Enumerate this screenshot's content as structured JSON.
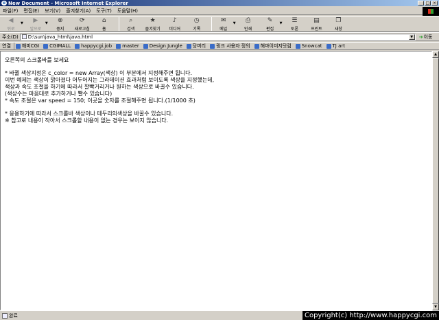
{
  "window": {
    "title": "New Document - Microsoft Internet Explorer",
    "buttons": {
      "minimize": "_",
      "maximize": "□",
      "close": "×"
    }
  },
  "menu": [
    "파일(F)",
    "편집(E)",
    "보기(V)",
    "즐겨찾기(A)",
    "도구(T)",
    "도움말(H)"
  ],
  "toolbar": {
    "back": "뒤로",
    "forward": "앞으로",
    "stop": "중지",
    "refresh": "새로고침",
    "home": "홈",
    "search": "검색",
    "favorites": "즐겨찾기",
    "media": "미디어",
    "history": "기록",
    "mail": "메일",
    "print": "인쇄",
    "edit": "편집",
    "discuss": "토론",
    "print_preview": "프린트",
    "messenger": "새창"
  },
  "address": {
    "label": "주소(D)",
    "value": "D:\\sun\\java_html\\java.html",
    "go": "이동"
  },
  "links": {
    "label": "연결",
    "items": [
      "해미CGI",
      "CGIMALL",
      "happycgi.job",
      "master",
      "Design Jungle",
      "당머리",
      "링크 사용자 정의",
      "해마이미지닷컴",
      "Snowcat",
      "TJ art"
    ]
  },
  "content": {
    "heading": "오른쪽의 스크롤바를 보세요",
    "lines1": [
      "* 바뀔 색상지정은 c_color = new Array(색상) 이 부분에서 지정해주면 됩니다.",
      "이번 예제는 색상이 밝아졌다 어두어지는 그라데이션 효과처럼 보이도록 색상을 지정했는데,",
      "색상과 속도 조절을 하기에 따라서 깔빡거리거나 원하는 색상으로 바꿀수 있습니다.",
      "(색상수는 마음대로 추가하거나 빨수 있습니다)",
      "* 속도 조절은 var speed = 150; 이곳을 숫자를 조절해주면 됩니다.(1/1000 초)"
    ],
    "lines2": [
      "* 응용하기에 따라서 스크롤바 색상이나 테두리의색상을 바꿀수 있습니다.",
      "※ 참고로 내용이 작아서 스크롤할 내용이 없는 경우는 보이지 않습니다."
    ]
  },
  "status": {
    "text": "완료",
    "copyright": "Copyright(c) http://www.happycgi.com"
  }
}
